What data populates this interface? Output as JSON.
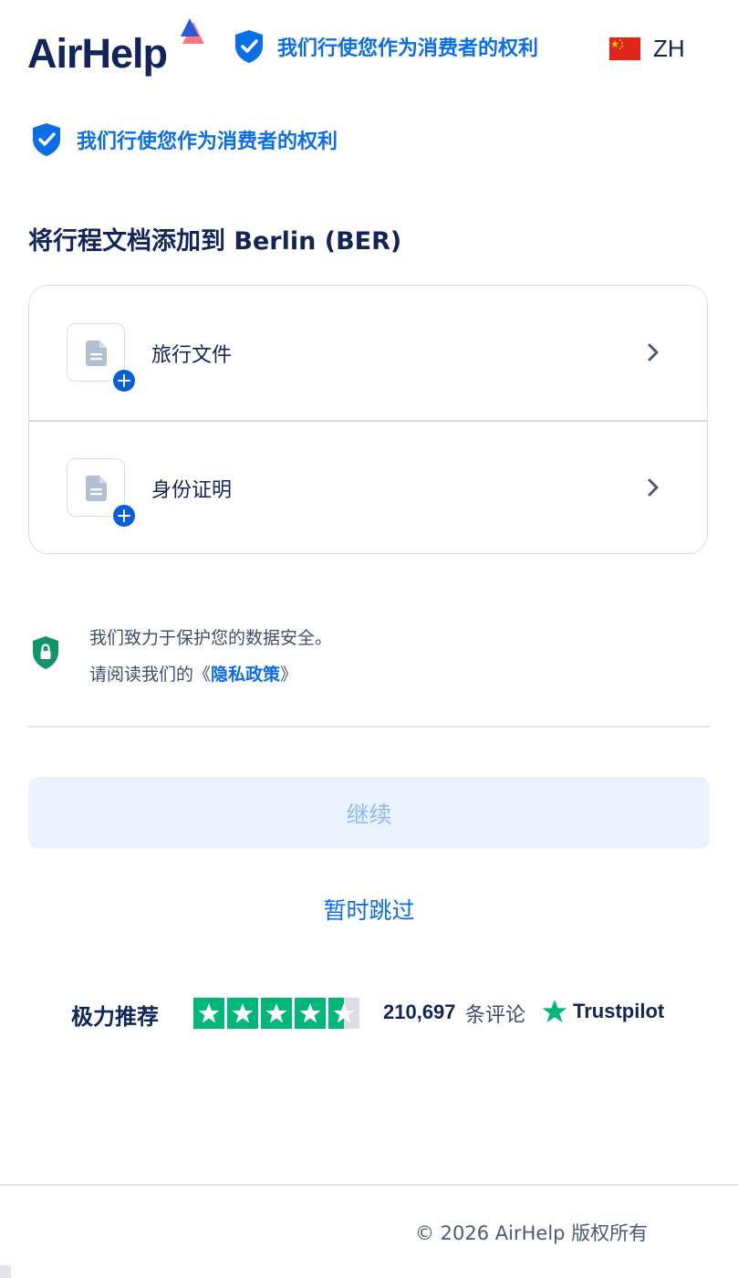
{
  "header": {
    "logo_text": "AirHelp",
    "rights_text": "我们行使您作为消费者的权利",
    "language_code": "ZH"
  },
  "rights_banner": {
    "text": "我们行使您作为消费者的权利"
  },
  "page": {
    "title": "将行程文档添加到 Berlin (BER)"
  },
  "documents": {
    "items": [
      {
        "label": "旅行文件",
        "icon": "document-icon"
      },
      {
        "label": "身份证明",
        "icon": "document-icon"
      }
    ]
  },
  "privacy": {
    "line1": "我们致力于保护您的数据安全。",
    "line2_prefix": "请阅读我们的",
    "open_bracket": "《",
    "link_text": "隐私政策",
    "close_bracket": "》"
  },
  "actions": {
    "continue_label": "继续",
    "skip_label": "暂时跳过"
  },
  "trustpilot": {
    "label": "极力推荐",
    "rating_fraction": 0.9,
    "review_count": "210,697",
    "review_suffix": "条评论",
    "brand": "Trustpilot"
  },
  "footer": {
    "copyright": "© 2026 AirHelp 版权所有"
  },
  "colors": {
    "brand_navy": "#12255a",
    "accent_blue": "#0a6ee6",
    "trustpilot_green": "#00b67a",
    "privacy_green": "#13936a",
    "disabled_button_bg": "#eaf3fd"
  }
}
